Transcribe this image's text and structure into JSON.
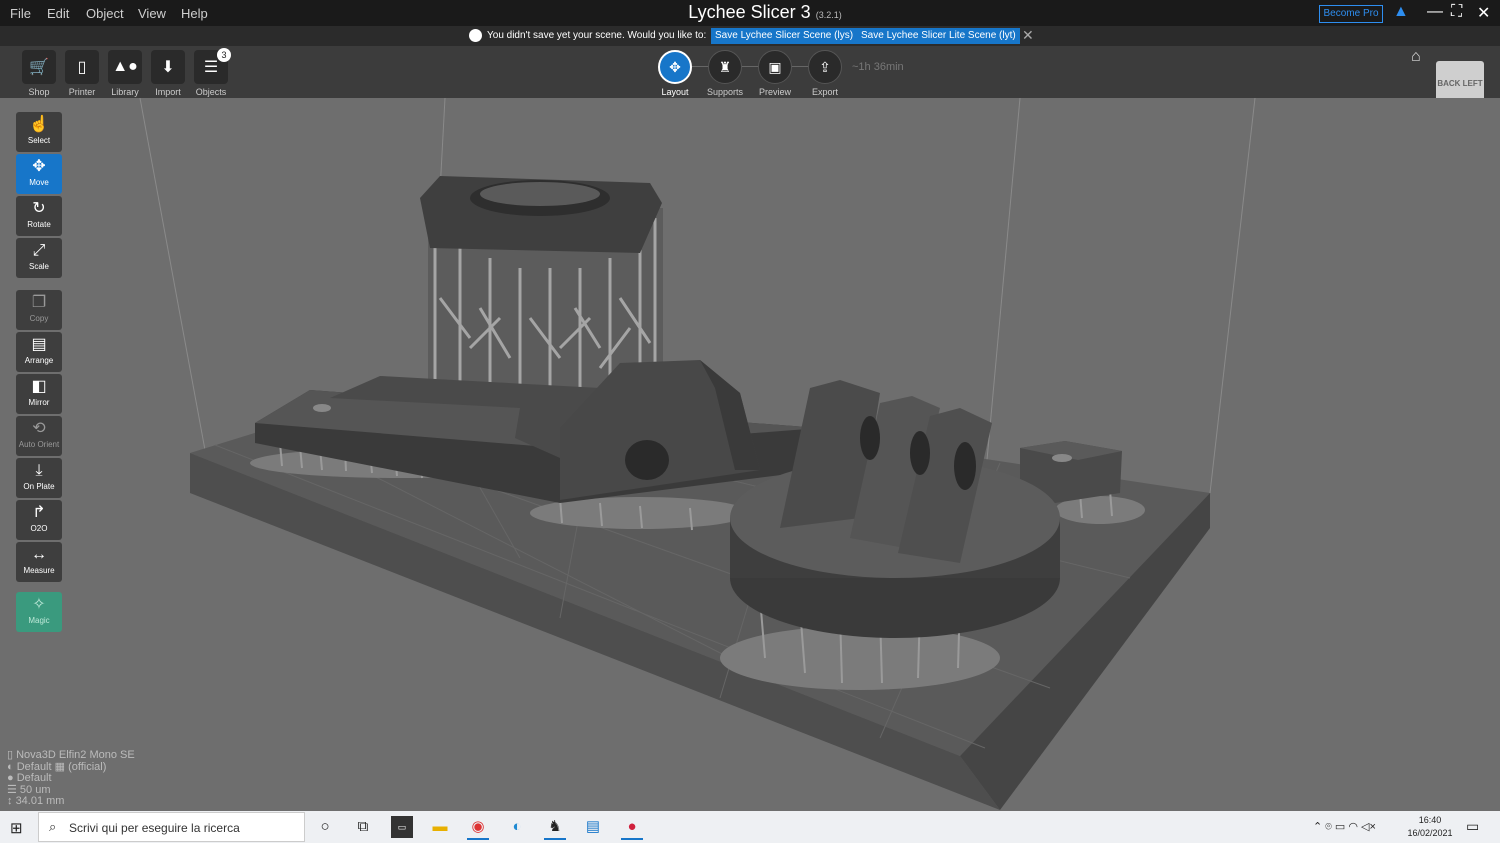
{
  "menu": [
    "File",
    "Edit",
    "Object",
    "View",
    "Help"
  ],
  "app": {
    "title": "Lychee Slicer 3",
    "version": "(3.2.1)",
    "become_pro": "Become Pro"
  },
  "notice": {
    "text": "You didn't save yet your scene. Would you like to:",
    "save_lys": "Save Lychee Slicer Scene (lys)",
    "save_lyt": "Save Lychee Slicer Lite Scene (lyt)"
  },
  "toolbar": {
    "shop": "Shop",
    "printer": "Printer",
    "library": "Library",
    "import": "Import",
    "objects": "Objects",
    "objects_count": "3"
  },
  "steps": {
    "layout": "Layout",
    "supports": "Supports",
    "preview": "Preview",
    "export": "Export",
    "time_estimate": "~1h 36min"
  },
  "view_cube_label": "BACK LEFT",
  "tools": {
    "select": "Select",
    "move": "Move",
    "rotate": "Rotate",
    "scale": "Scale",
    "copy": "Copy",
    "arrange": "Arrange",
    "mirror": "Mirror",
    "auto_orient": "Auto Orient",
    "on_plate": "On Plate",
    "o2o": "O2O",
    "measure": "Measure",
    "magic": "Magic"
  },
  "printer_info": {
    "printer": "Nova3D Elfin2 Mono SE",
    "resin": "Default",
    "resin_tag": "(official)",
    "profile": "Default",
    "layer": "50 um",
    "height": "34.01 mm"
  },
  "taskbar": {
    "search_placeholder": "Scrivi qui per eseguire la ricerca",
    "time": "16:40",
    "date": "16/02/2021"
  },
  "colors": {
    "accent": "#1776c9",
    "magic": "#3a9a7e",
    "viewport": "#6e6e6e"
  }
}
